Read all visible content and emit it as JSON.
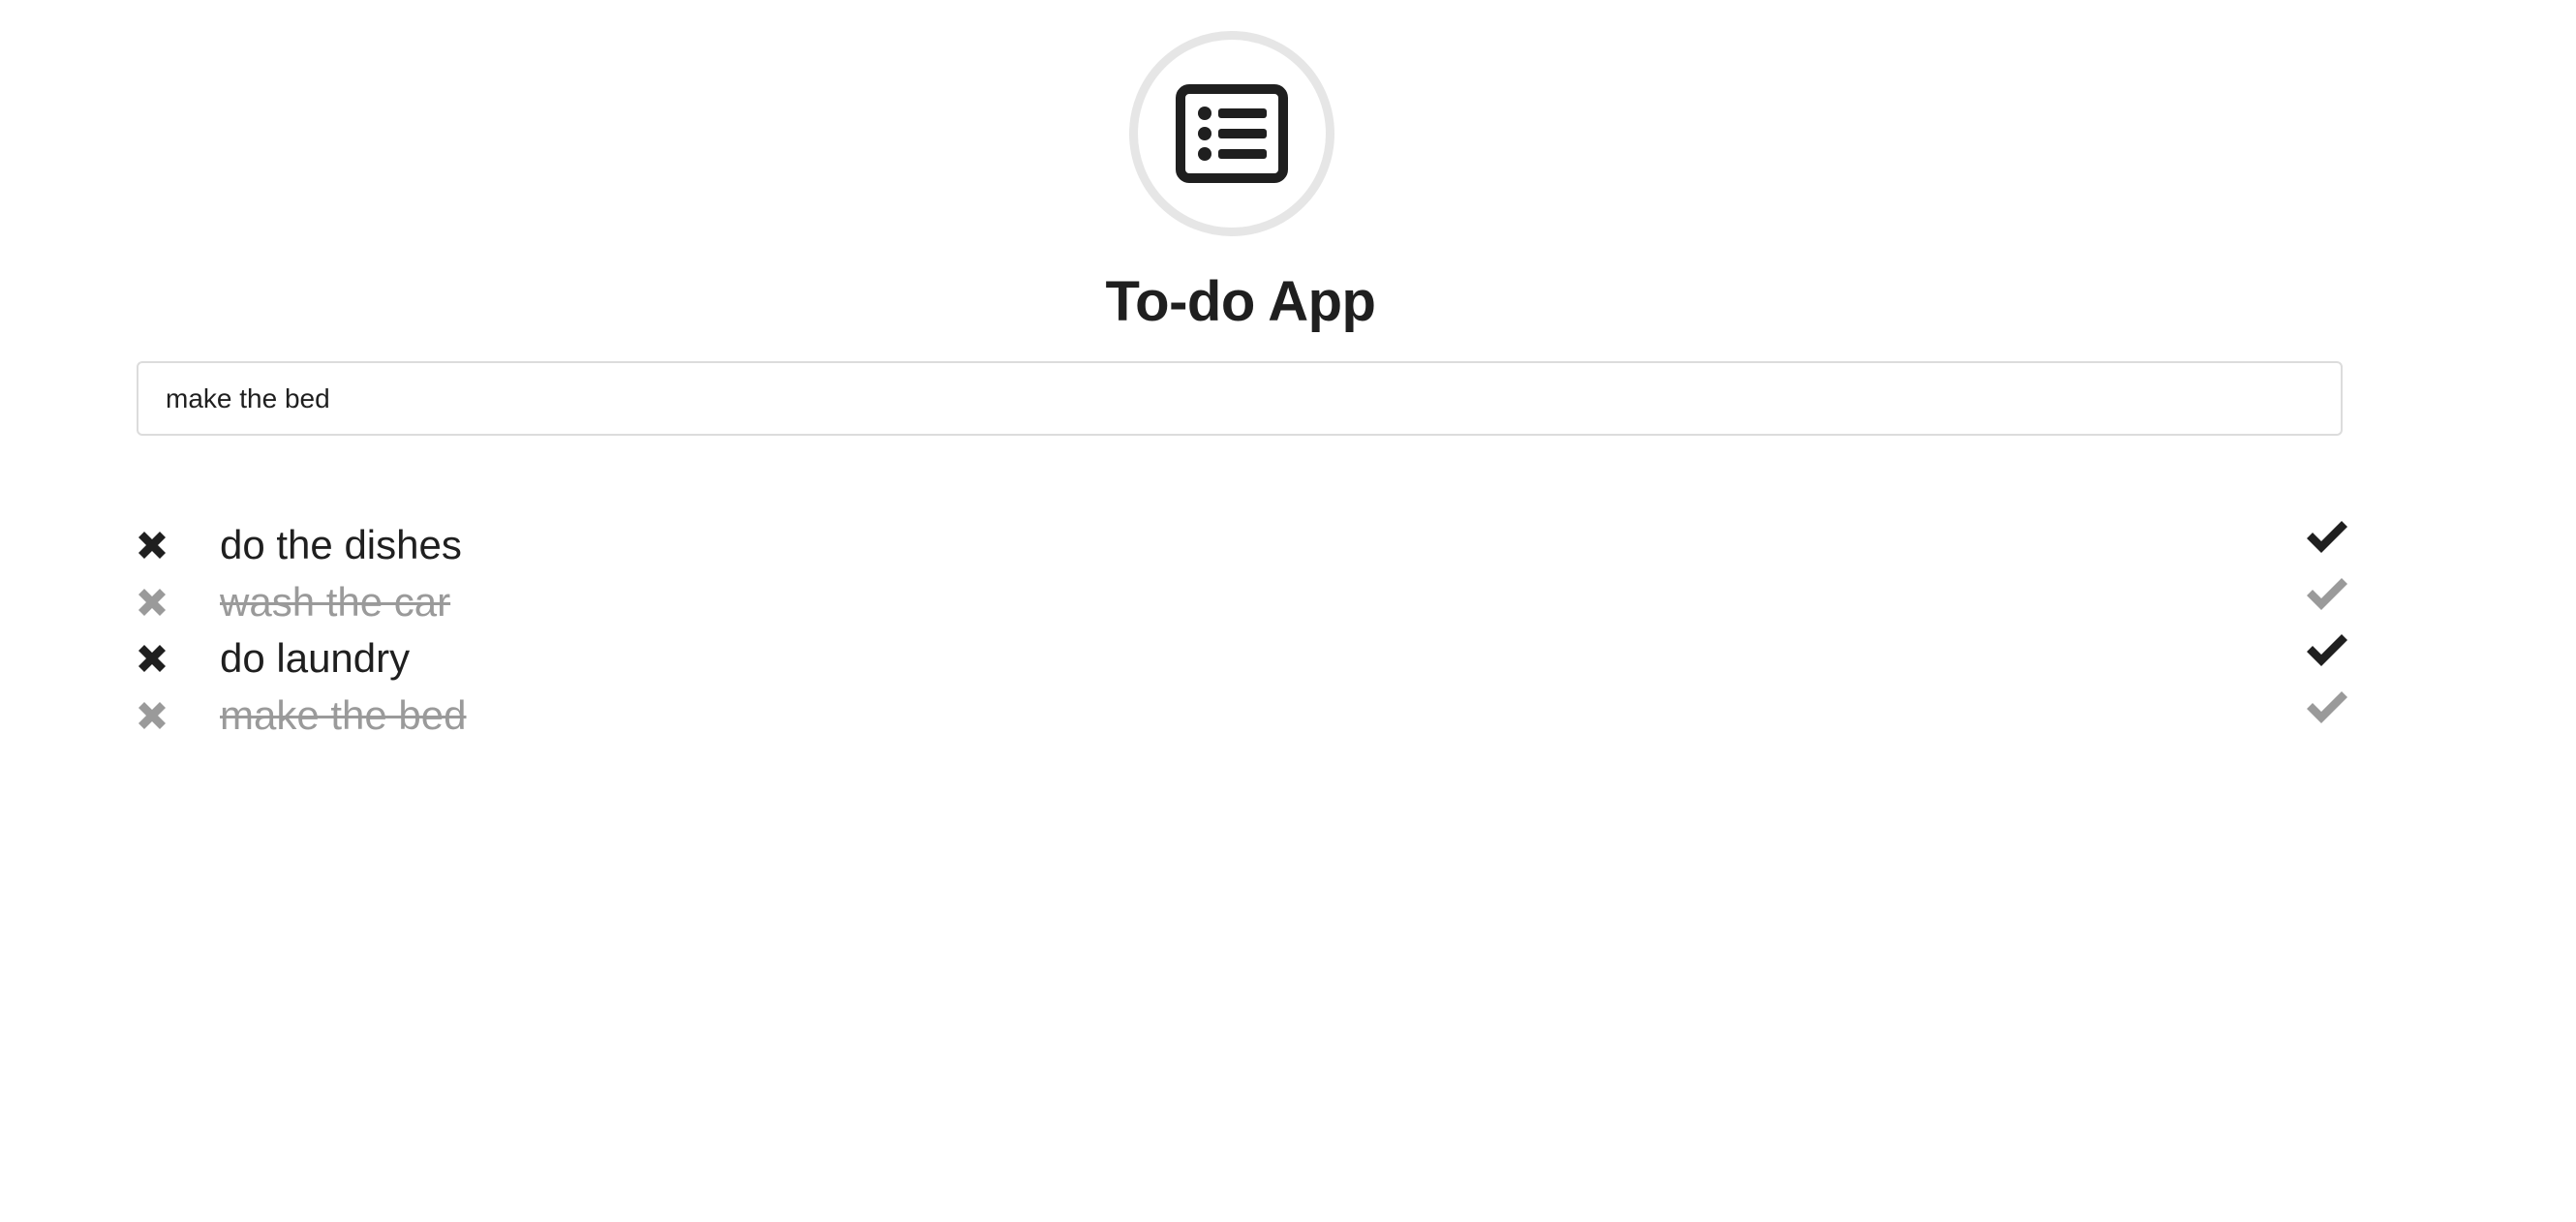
{
  "app": {
    "title": "To-do App"
  },
  "logo": {
    "icon": "list-alt-icon"
  },
  "new_todo": {
    "value": "make the bed"
  },
  "todos": [
    {
      "text": "do the dishes",
      "done": false
    },
    {
      "text": "wash the car",
      "done": true
    },
    {
      "text": "do laundry",
      "done": false
    },
    {
      "text": "make the bed",
      "done": true
    }
  ],
  "icons": {
    "delete": "times-icon",
    "complete": "check-icon"
  },
  "colors": {
    "text": "#1f1f1f",
    "done": "#9a9a9a",
    "logo_ring": "#e6e6e6",
    "input_border": "#dcdcdc"
  }
}
